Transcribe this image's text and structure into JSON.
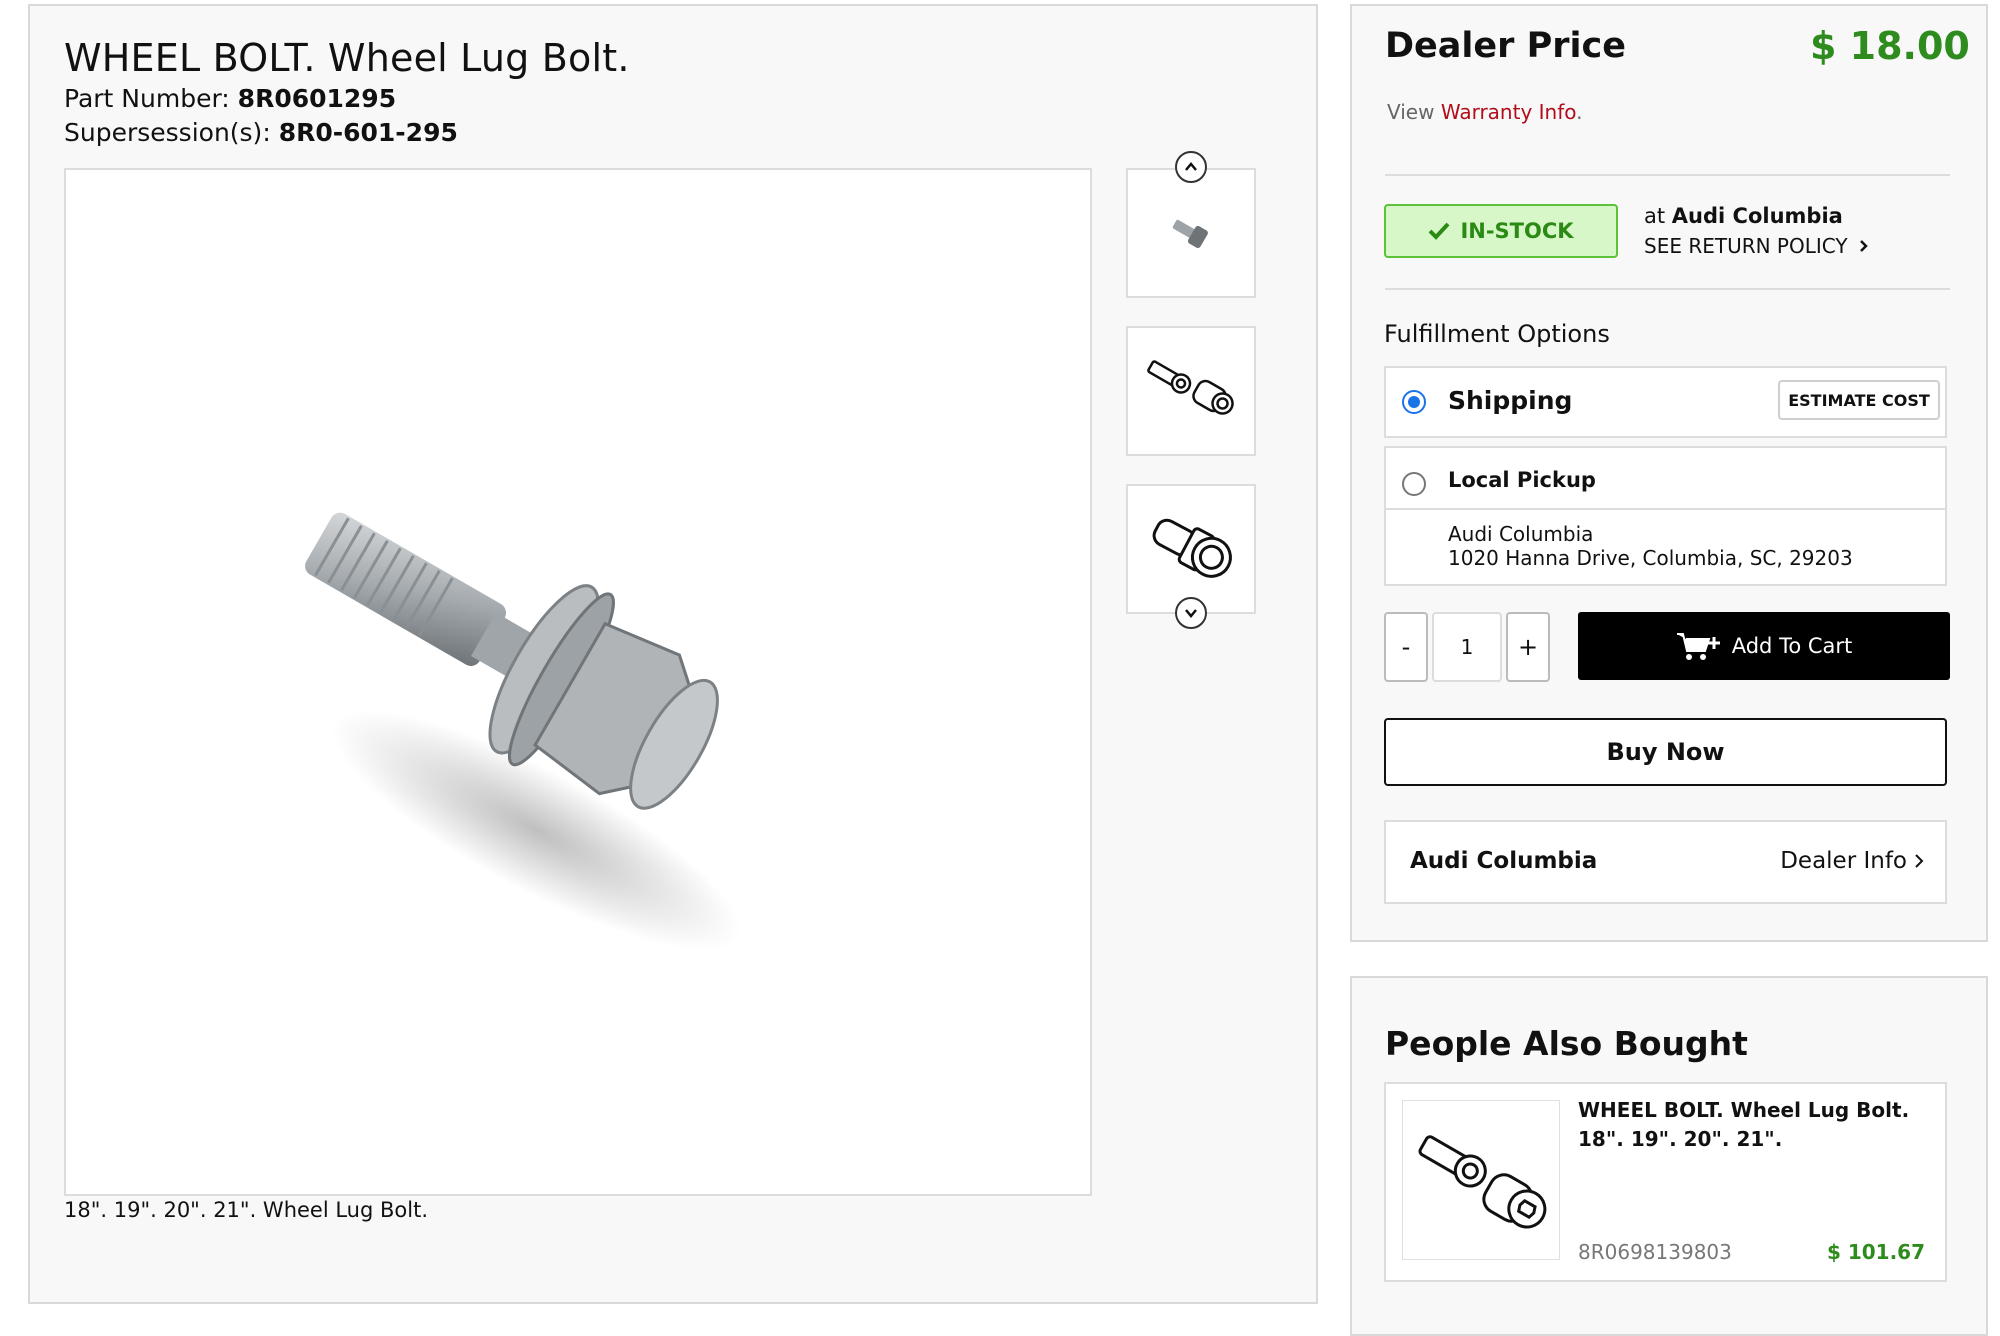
{
  "product": {
    "title": "WHEEL BOLT. Wheel Lug Bolt.",
    "part_number_label": "Part Number:",
    "part_number": "8R0601295",
    "supersession_label": "Supersession(s):",
    "supersession": "8R0-601-295",
    "caption": "18\". 19\". 20\". 21\". Wheel Lug Bolt."
  },
  "gallery": {
    "thumbnails": [
      "bolt-photo-thumbnail",
      "bolt-and-lock-diagram-thumbnail",
      "bolt-diagram-thumbnail"
    ],
    "scroll_up_icon": "chevron-up-icon",
    "scroll_down_icon": "chevron-down-icon"
  },
  "pricing": {
    "label": "Dealer Price",
    "price": "$ 18.00",
    "price_color": "#2e8b1d",
    "warranty_prefix": "View",
    "warranty_link": "Warranty Info",
    "warranty_suffix": "."
  },
  "stock": {
    "badge": "IN-STOCK",
    "badge_icon": "checkmark-icon",
    "at_prefix": "at",
    "dealer": "Audi Columbia",
    "return_policy": "SEE RETURN POLICY"
  },
  "fulfillment": {
    "label": "Fulfillment Options",
    "shipping": {
      "label": "Shipping",
      "selected": true,
      "estimate_button": "ESTIMATE COST"
    },
    "pickup": {
      "label": "Local Pickup",
      "selected": false,
      "dealer": "Audi Columbia",
      "address": "1020 Hanna Drive, Columbia, SC, 29203"
    }
  },
  "cart": {
    "decrement": "-",
    "quantity": "1",
    "increment": "+",
    "add_to_cart": "Add To Cart",
    "buy_now": "Buy Now"
  },
  "dealer_info": {
    "name": "Audi Columbia",
    "link": "Dealer Info"
  },
  "people_also_bought": {
    "title": "People Also Bought",
    "items": [
      {
        "title": "WHEEL BOLT. Wheel Lug Bolt. 18\". 19\". 20\". 21\".",
        "part_number": "8R0698139803",
        "price": "$ 101.67"
      }
    ]
  },
  "colors": {
    "accent_green": "#2e8b1d",
    "instock_bg": "#d8f7c8",
    "instock_border": "#5cc23a",
    "link_red": "#b10d1a",
    "radio_blue": "#1a73e8"
  }
}
